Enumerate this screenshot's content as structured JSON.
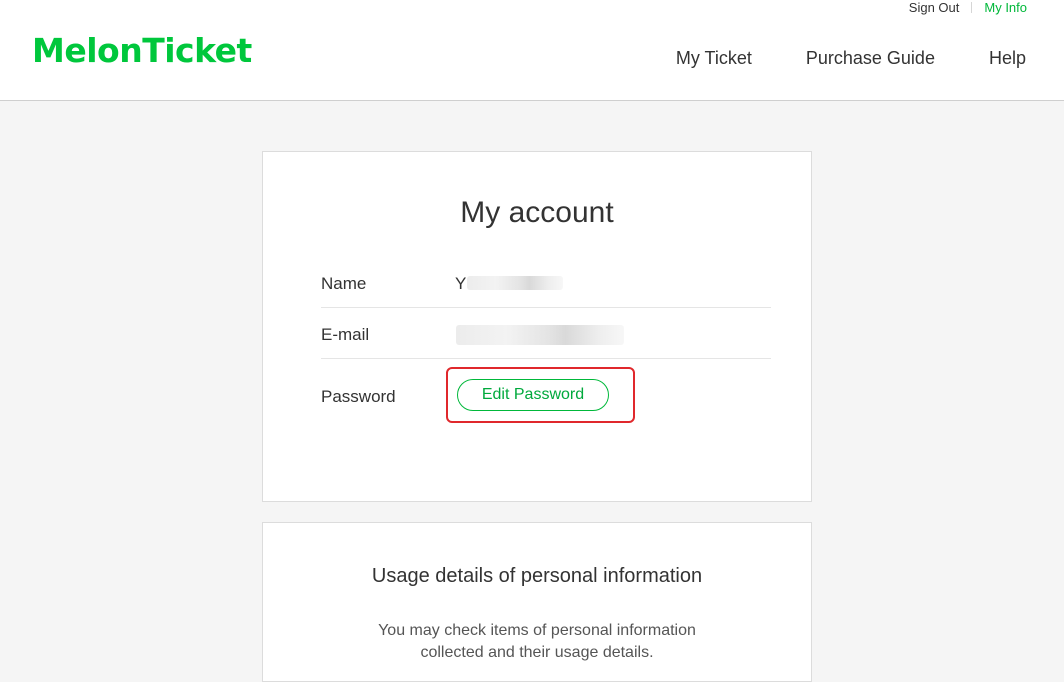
{
  "header": {
    "logo": "MelonTicket",
    "utility": {
      "sign_out": "Sign Out",
      "my_info": "My Info"
    },
    "nav": [
      "My Ticket",
      "Purchase Guide",
      "Help"
    ]
  },
  "account": {
    "title": "My account",
    "rows": [
      {
        "label": "Name",
        "value_visible": "Y"
      },
      {
        "label": "E-mail"
      },
      {
        "label": "Password",
        "button": "Edit Password"
      }
    ]
  },
  "usage": {
    "title": "Usage details of personal information",
    "desc_line1": "You may check items of personal information",
    "desc_line2": "collected and their usage details."
  },
  "colors": {
    "brand": "#00c73c",
    "highlight": "#e0282c"
  }
}
